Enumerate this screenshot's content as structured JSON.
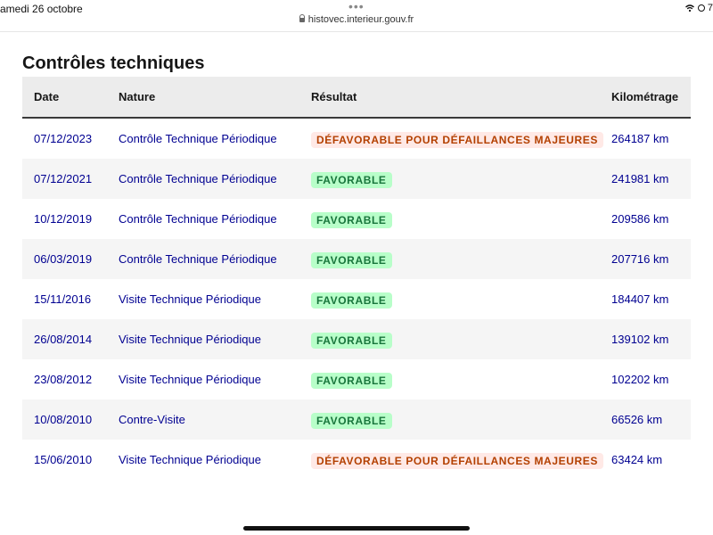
{
  "status_bar": {
    "date": "amedi 26 octobre",
    "url": "histovec.interieur.gouv.fr",
    "battery_fragment": "7"
  },
  "page": {
    "title": "Contrôles techniques"
  },
  "table": {
    "headers": {
      "date": "Date",
      "nature": "Nature",
      "result": "Résultat",
      "km": "Kilométrage"
    },
    "rows": [
      {
        "date": "07/12/2023",
        "nature": "Contrôle Technique Périodique",
        "result": "DÉFAVORABLE POUR DÉFAILLANCES MAJEURES",
        "status": "defavorable",
        "km": "264187 km"
      },
      {
        "date": "07/12/2021",
        "nature": "Contrôle Technique Périodique",
        "result": "FAVORABLE",
        "status": "favorable",
        "km": "241981 km"
      },
      {
        "date": "10/12/2019",
        "nature": "Contrôle Technique Périodique",
        "result": "FAVORABLE",
        "status": "favorable",
        "km": "209586 km"
      },
      {
        "date": "06/03/2019",
        "nature": "Contrôle Technique Périodique",
        "result": "FAVORABLE",
        "status": "favorable",
        "km": "207716 km"
      },
      {
        "date": "15/11/2016",
        "nature": "Visite Technique Périodique",
        "result": "FAVORABLE",
        "status": "favorable",
        "km": "184407 km"
      },
      {
        "date": "26/08/2014",
        "nature": "Visite Technique Périodique",
        "result": "FAVORABLE",
        "status": "favorable",
        "km": "139102 km"
      },
      {
        "date": "23/08/2012",
        "nature": "Visite Technique Périodique",
        "result": "FAVORABLE",
        "status": "favorable",
        "km": "102202 km"
      },
      {
        "date": "10/08/2010",
        "nature": "Contre-Visite",
        "result": "FAVORABLE",
        "status": "favorable",
        "km": "66526 km"
      },
      {
        "date": "15/06/2010",
        "nature": "Visite Technique Périodique",
        "result": "DÉFAVORABLE POUR DÉFAILLANCES MAJEURES",
        "status": "defavorable",
        "km": "63424 km"
      }
    ]
  },
  "colors": {
    "link_text": "#000091",
    "favorable_bg": "#b8fec9",
    "favorable_text": "#18753c",
    "defavorable_bg": "#ffe9e6",
    "defavorable_text": "#b34000"
  }
}
